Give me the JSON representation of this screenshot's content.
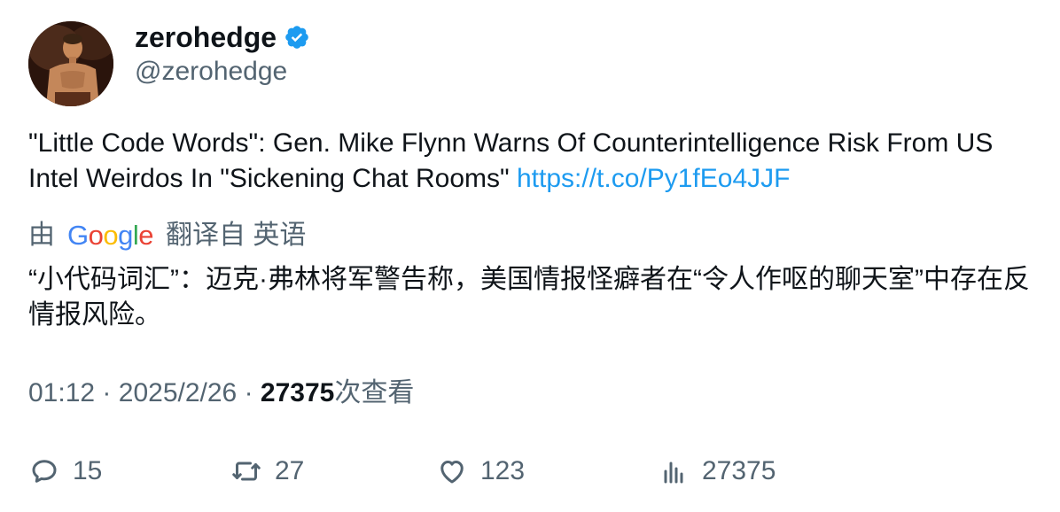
{
  "author": {
    "display_name": "zerohedge",
    "handle": "@zerohedge",
    "verified": true,
    "verified_color": "#1d9bf0"
  },
  "tweet": {
    "text": "\"Little Code Words\": Gen. Mike Flynn Warns Of Counterintelligence Risk From US Intel Weirdos In \"Sickening Chat Rooms\"",
    "link": "https://t.co/Py1fEo4JJF",
    "link_color": "#1d9bf0"
  },
  "translation": {
    "prefix": "由",
    "provider": "Google",
    "suffix": "翻译自 英语",
    "text": "“小代码词汇”：迈克·弗林将军警告称，美国情报怪癖者在“令人作呕的聊天室”中存在反情报风险。"
  },
  "meta": {
    "time": "01:12",
    "separator": "·",
    "date": "2025/2/26",
    "views_count": "27375",
    "views_label": "次查看"
  },
  "actions": {
    "reply_icon": "reply-icon",
    "reply_count": "15",
    "retweet_icon": "retweet-icon",
    "retweet_count": "27",
    "like_icon": "heart-icon",
    "like_count": "123",
    "views_icon": "analytics-icon",
    "views_count": "27375"
  }
}
